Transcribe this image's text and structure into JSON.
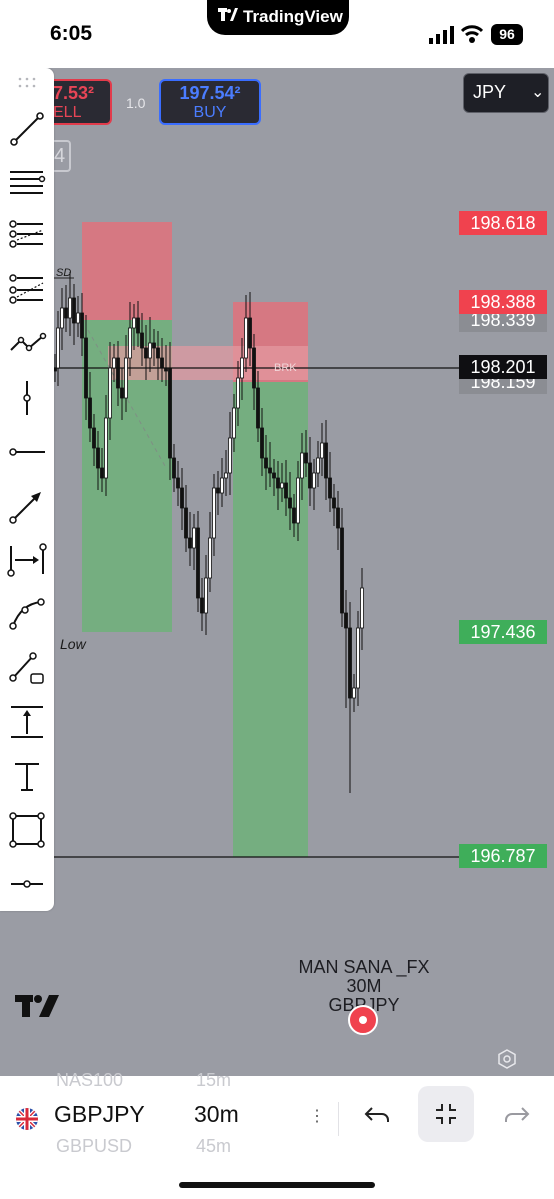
{
  "status": {
    "time": "6:05",
    "app_name": "TradingView",
    "battery": "96"
  },
  "trade": {
    "sell_price": "7.53²",
    "sell_label": "ELL",
    "spread": "1.0",
    "buy_price": "197.54²",
    "buy_label": "BUY",
    "partial_box": "4",
    "currency": "JPY"
  },
  "price_labels": {
    "p1": "198.618",
    "p2": "198.388",
    "p3": "198.339",
    "p4": "198.201",
    "p5": "198.159",
    "p6": "197.436",
    "p7": "196.787"
  },
  "chart_text": {
    "sd_label": "SD",
    "low_label": "Low",
    "brk_label": "BRK"
  },
  "watermark": {
    "line1": "MAN SANA _FX",
    "line2": "30M",
    "line3": "GBPJPY"
  },
  "bottom": {
    "ghost_symbol_above": "NAS100",
    "ghost_interval_above": "15m",
    "symbol": "GBPJPY",
    "interval": "30m",
    "ghost_symbol_below": "GBPUSD",
    "ghost_interval_below": "45m"
  },
  "colors": {
    "chart_bg": "#9a9ca4",
    "red_zone": "#e0727d",
    "green_zone": "#6fb17a",
    "sell": "#e84556",
    "buy": "#4b7dff"
  },
  "toolbar_icons": [
    "drag-handle-icon",
    "trend-line-icon",
    "horizontal-lines-icon",
    "pitchfork-icon",
    "fib-retracement-icon",
    "polyline-icon",
    "vertical-line-icon",
    "horizontal-ray-icon",
    "arrow-icon",
    "date-range-icon",
    "curve-icon",
    "long-position-icon",
    "price-range-icon",
    "text-icon",
    "rectangle-icon",
    "horizontal-line-icon"
  ]
}
